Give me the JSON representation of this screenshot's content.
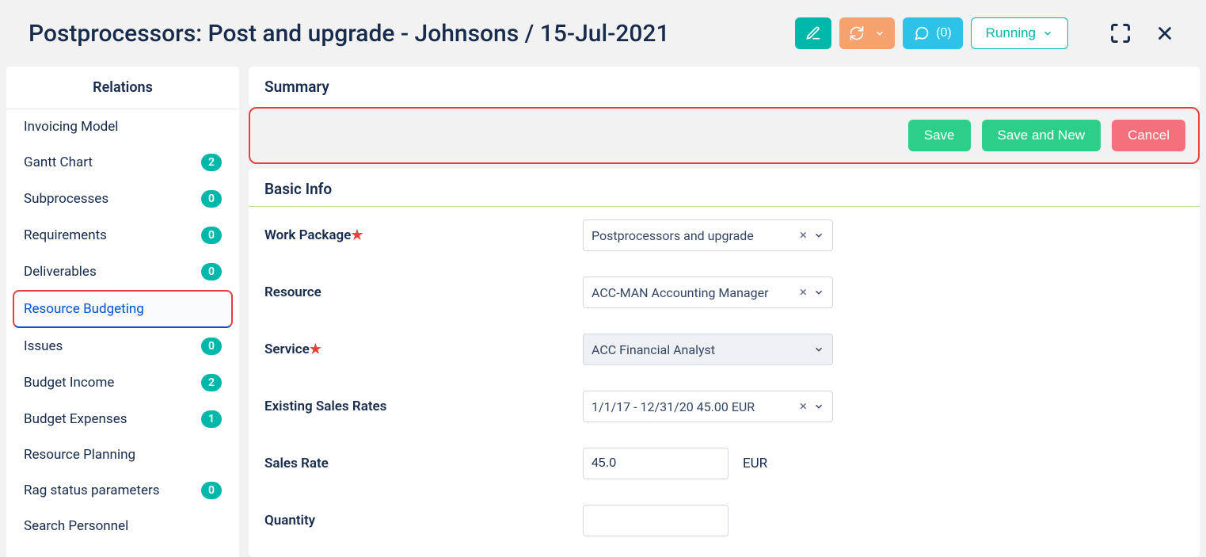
{
  "header": {
    "title": "Postprocessors: Post and upgrade - Johnsons / 15-Jul-2021",
    "comments_label": "(0)",
    "status_label": "Running"
  },
  "sidebar": {
    "title": "Relations",
    "items": [
      {
        "label": "Invoicing Model",
        "badge": null
      },
      {
        "label": "Gantt Chart",
        "badge": "2"
      },
      {
        "label": "Subprocesses",
        "badge": "0"
      },
      {
        "label": "Requirements",
        "badge": "0"
      },
      {
        "label": "Deliverables",
        "badge": "0"
      },
      {
        "label": "Resource Budgeting",
        "badge": null
      },
      {
        "label": "Issues",
        "badge": "0"
      },
      {
        "label": "Budget Income",
        "badge": "2"
      },
      {
        "label": "Budget Expenses",
        "badge": "1"
      },
      {
        "label": "Resource Planning",
        "badge": null
      },
      {
        "label": "Rag status parameters",
        "badge": "0"
      },
      {
        "label": "Search Personnel",
        "badge": null
      }
    ]
  },
  "summary": {
    "title": "Summary"
  },
  "actions": {
    "save": "Save",
    "save_new": "Save and New",
    "cancel": "Cancel"
  },
  "form": {
    "title": "Basic Info",
    "labels": {
      "work_package": "Work Package",
      "resource": "Resource",
      "service": "Service",
      "existing_rates": "Existing Sales Rates",
      "sales_rate": "Sales Rate",
      "quantity": "Quantity"
    },
    "values": {
      "work_package": "Postprocessors and upgrade",
      "resource": "ACC-MAN Accounting Manager",
      "service": "ACC Financial Analyst",
      "existing_rates": "1/1/17 - 12/31/20 45.00 EUR",
      "sales_rate": "45.0",
      "currency": "EUR",
      "quantity": ""
    }
  }
}
